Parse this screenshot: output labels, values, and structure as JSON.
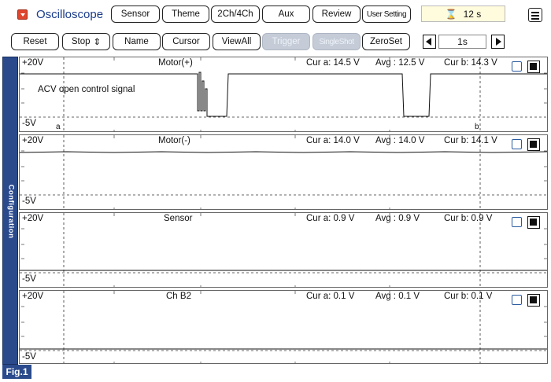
{
  "app": {
    "title": "Oscilloscope"
  },
  "toolbar1": {
    "sensor": "Sensor",
    "theme": "Theme",
    "channels": "2Ch/4Ch",
    "aux": "Aux",
    "review": "Review",
    "user_setting": "User Setting",
    "timer_value": "12 s"
  },
  "toolbar2": {
    "reset": "Reset",
    "stop": "Stop",
    "stop_arrows": "⇕",
    "name": "Name",
    "cursor": "Cursor",
    "viewall": "ViewAll",
    "trigger": "Trigger",
    "singleshot": "SingleShot",
    "zeroset": "ZeroSet",
    "timebase": "1s"
  },
  "sidebar": {
    "label": "Configuration"
  },
  "figure": {
    "label": "Fig.1"
  },
  "cursors": {
    "a": "a",
    "b": "b"
  },
  "channels": [
    {
      "name": "Motor(+)",
      "max": "+20V",
      "min": "-5V",
      "cur_a": "Cur a: 14.5 V",
      "avg": "Avg   : 12.5 V",
      "cur_b": "Cur b: 14.3 V",
      "annotation": "ACV open control signal"
    },
    {
      "name": "Motor(-)",
      "max": "+20V",
      "min": "-5V",
      "cur_a": "Cur a: 14.0 V",
      "avg": "Avg   : 14.0 V",
      "cur_b": "Cur b: 14.1 V"
    },
    {
      "name": "Sensor",
      "max": "+20V",
      "min": "-5V",
      "cur_a": "Cur a: 0.9 V",
      "avg": "Avg   : 0.9 V",
      "cur_b": "Cur b: 0.9 V"
    },
    {
      "name": "Ch B2",
      "max": "+20V",
      "min": "-5V",
      "cur_a": "Cur a: 0.1 V",
      "avg": "Avg   : 0.1 V",
      "cur_b": "Cur b: 0.1 V"
    }
  ],
  "colors": {
    "sidebar": "#2a4a8c",
    "title": "#1a3c8c",
    "menu_icon": "#e0452e",
    "checkbox": "#2a5aa0",
    "disabled": "#c5ccd8"
  }
}
